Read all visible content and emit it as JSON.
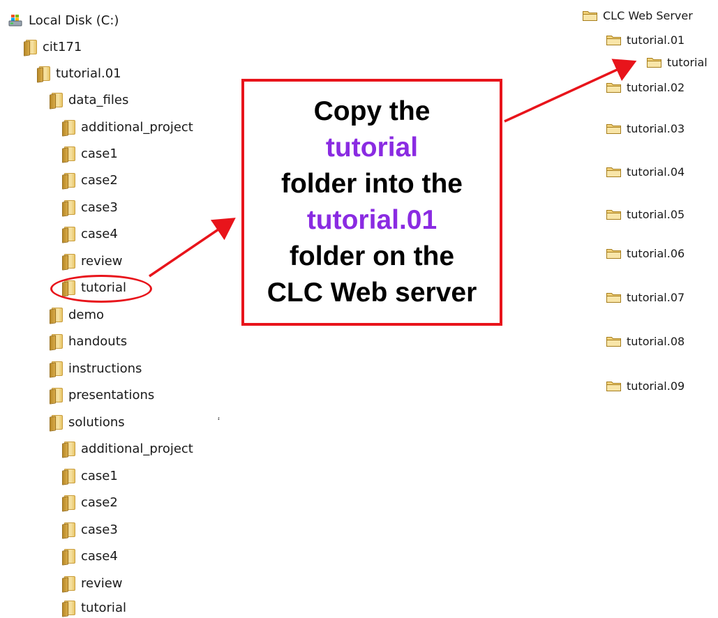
{
  "local_tree": {
    "drive_label": "Local Disk (C:)",
    "cit171": "cit171",
    "tutorial01": "tutorial.01",
    "data_files": "data_files",
    "data_children": [
      "additional_project",
      "case1",
      "case2",
      "case3",
      "case4",
      "review",
      "tutorial"
    ],
    "siblings": [
      "demo",
      "handouts",
      "instructions",
      "presentations",
      "solutions"
    ],
    "solutions_children": [
      "additional_project",
      "case1",
      "case2",
      "case3",
      "case4",
      "review",
      "tutorial"
    ]
  },
  "server_tree": {
    "root": "CLC Web Server",
    "tutorial01": "tutorial.01",
    "tutorial_nested": "tutorial",
    "others": [
      "tutorial.02",
      "tutorial.03",
      "tutorial.04",
      "tutorial.05",
      "tutorial.06",
      "tutorial.07",
      "tutorial.08",
      "tutorial.09"
    ]
  },
  "callout": {
    "line1": "Copy the",
    "line2": "tutorial",
    "line3": "folder into the",
    "line4": "tutorial.01",
    "line5": "folder on the",
    "line6": "CLC Web server"
  },
  "stray_mark": "፡",
  "colors": {
    "annotation_red": "#e8141b",
    "highlight_purple": "#8a2be2"
  },
  "icons": {
    "drive": "drive-icon",
    "local_folder": "folder-icon",
    "server_folder": "folder-icon"
  }
}
